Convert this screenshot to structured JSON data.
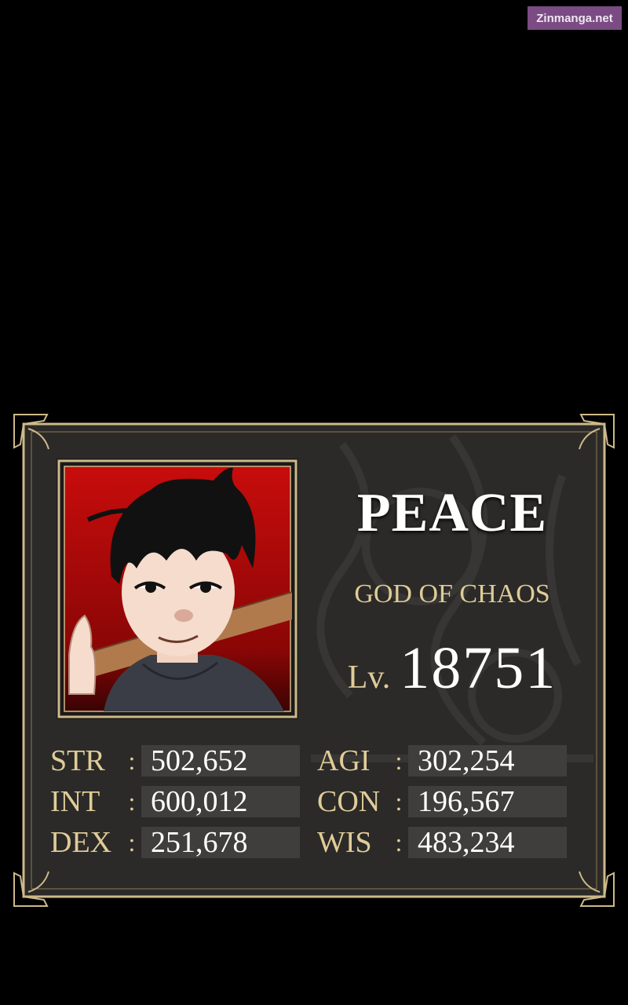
{
  "watermark": "Zinmanga.net",
  "character": {
    "name": "PEACE",
    "title": "GOD OF CHAOS",
    "level_label": "Lv.",
    "level_value": "18751"
  },
  "stats": [
    {
      "label": "STR",
      "value": "502,652"
    },
    {
      "label": "AGI",
      "value": "302,254"
    },
    {
      "label": "INT",
      "value": "600,012"
    },
    {
      "label": "CON",
      "value": "196,567"
    },
    {
      "label": "DEX",
      "value": "251,678"
    },
    {
      "label": "WIS",
      "value": "483,234"
    }
  ],
  "colors": {
    "background": "#000000",
    "panel": "#2b2a28",
    "frame_gold": "#cdb98a",
    "label_gold": "#e0cc98",
    "value_box": "#3f3e3c",
    "portrait_red": "#c80c0c"
  }
}
